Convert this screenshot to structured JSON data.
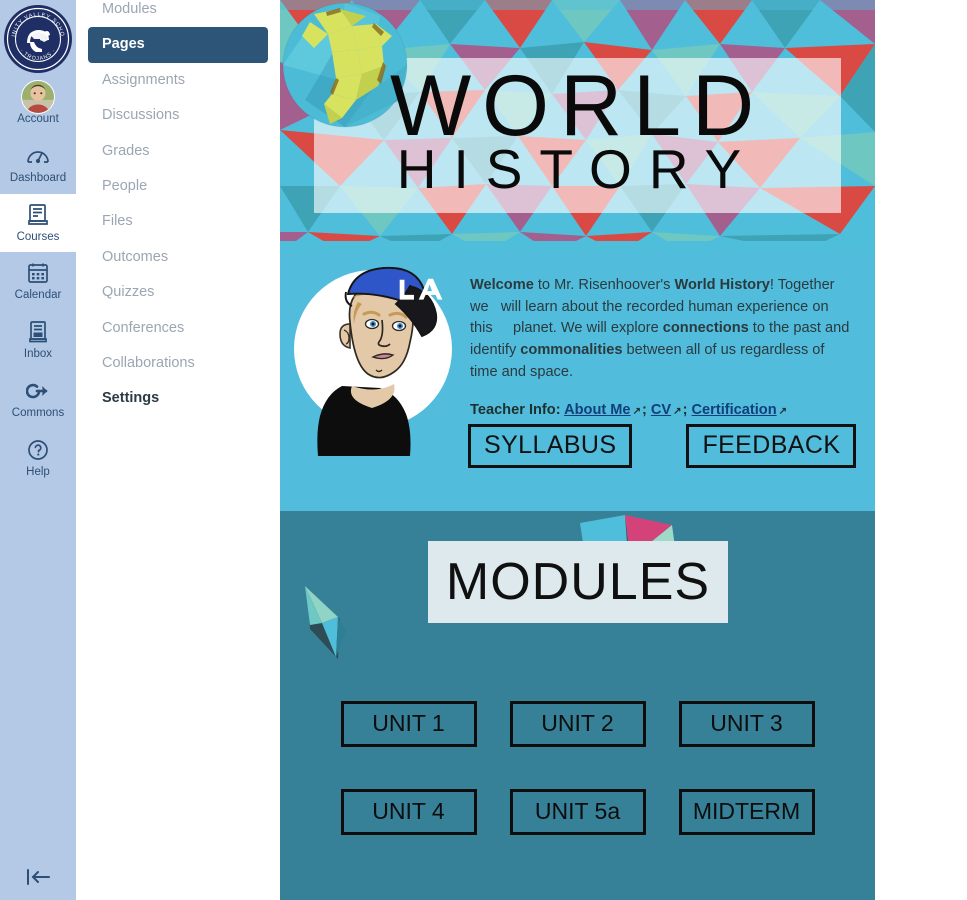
{
  "global_nav": {
    "logo": {
      "name": "trinity-valley-school-seal",
      "top_text": "TRINITY VALLEY SCHOOL",
      "bottom_text": "TROJANS"
    },
    "items": [
      {
        "label": "Account",
        "icon": "user-avatar-photo",
        "active": false
      },
      {
        "label": "Dashboard",
        "icon": "dashboard-icon",
        "active": false
      },
      {
        "label": "Courses",
        "icon": "courses-book-icon",
        "active": true
      },
      {
        "label": "Calendar",
        "icon": "calendar-icon",
        "active": false
      },
      {
        "label": "Inbox",
        "icon": "inbox-icon",
        "active": false
      },
      {
        "label": "Commons",
        "icon": "commons-icon",
        "active": false
      },
      {
        "label": "Help",
        "icon": "help-question-icon",
        "active": false
      }
    ],
    "collapse_label": "Collapse navigation",
    "collapse_icon": "collapse-left-icon"
  },
  "course_nav": {
    "items": [
      {
        "label": "Modules",
        "state": "muted"
      },
      {
        "label": "Pages",
        "state": "active"
      },
      {
        "label": "Assignments",
        "state": "muted"
      },
      {
        "label": "Discussions",
        "state": "muted"
      },
      {
        "label": "Grades",
        "state": "muted"
      },
      {
        "label": "People",
        "state": "muted"
      },
      {
        "label": "Files",
        "state": "muted"
      },
      {
        "label": "Outcomes",
        "state": "muted"
      },
      {
        "label": "Quizzes",
        "state": "muted"
      },
      {
        "label": "Conferences",
        "state": "muted"
      },
      {
        "label": "Collaborations",
        "state": "muted"
      },
      {
        "label": "Settings",
        "state": "solid"
      }
    ]
  },
  "banner": {
    "line1": "WORLD",
    "line2": "HISTORY",
    "globe_icon": "low-poly-globe"
  },
  "welcome": {
    "portrait_icon": "teacher-cartoon-portrait",
    "paragraph_html": "<b>Welcome</b> to Mr. Risenhoover's <b>World History</b>! Together we &nbsp; will learn about the recorded human experience on this &nbsp; &nbsp; planet. We will explore <b>connections</b> to the past and identify <b>commonalities</b> between all of us regardless of time and space.",
    "teacher_info_label": "Teacher Info:",
    "links": [
      {
        "label": "About Me",
        "icon": "external-link-icon"
      },
      {
        "label": "CV",
        "icon": "external-link-icon"
      },
      {
        "label": "Certification",
        "icon": "external-link-icon"
      }
    ],
    "link_separator": ";",
    "buttons": [
      {
        "label": "SYLLABUS"
      },
      {
        "label": "FEEDBACK"
      }
    ]
  },
  "modules": {
    "title": "MODULES",
    "units": [
      {
        "label": "UNIT 1"
      },
      {
        "label": "UNIT 2"
      },
      {
        "label": "UNIT 3"
      },
      {
        "label": "UNIT 4"
      },
      {
        "label": "UNIT 5a"
      },
      {
        "label": "MIDTERM"
      }
    ]
  },
  "colors": {
    "global_nav_bg": "#b3c9e6",
    "global_nav_text": "#2d4f77",
    "course_nav_active_bg": "#2d5578",
    "banner_base": "#4fbedb",
    "welcome_bg": "#52bcdc",
    "modules_bg": "#368198",
    "modules_plate": "#dde9ed",
    "link_blue": "#123f7a",
    "accent_red": "#d94141",
    "accent_mauve": "#b0628c",
    "accent_teal": "#3fa9b8"
  }
}
